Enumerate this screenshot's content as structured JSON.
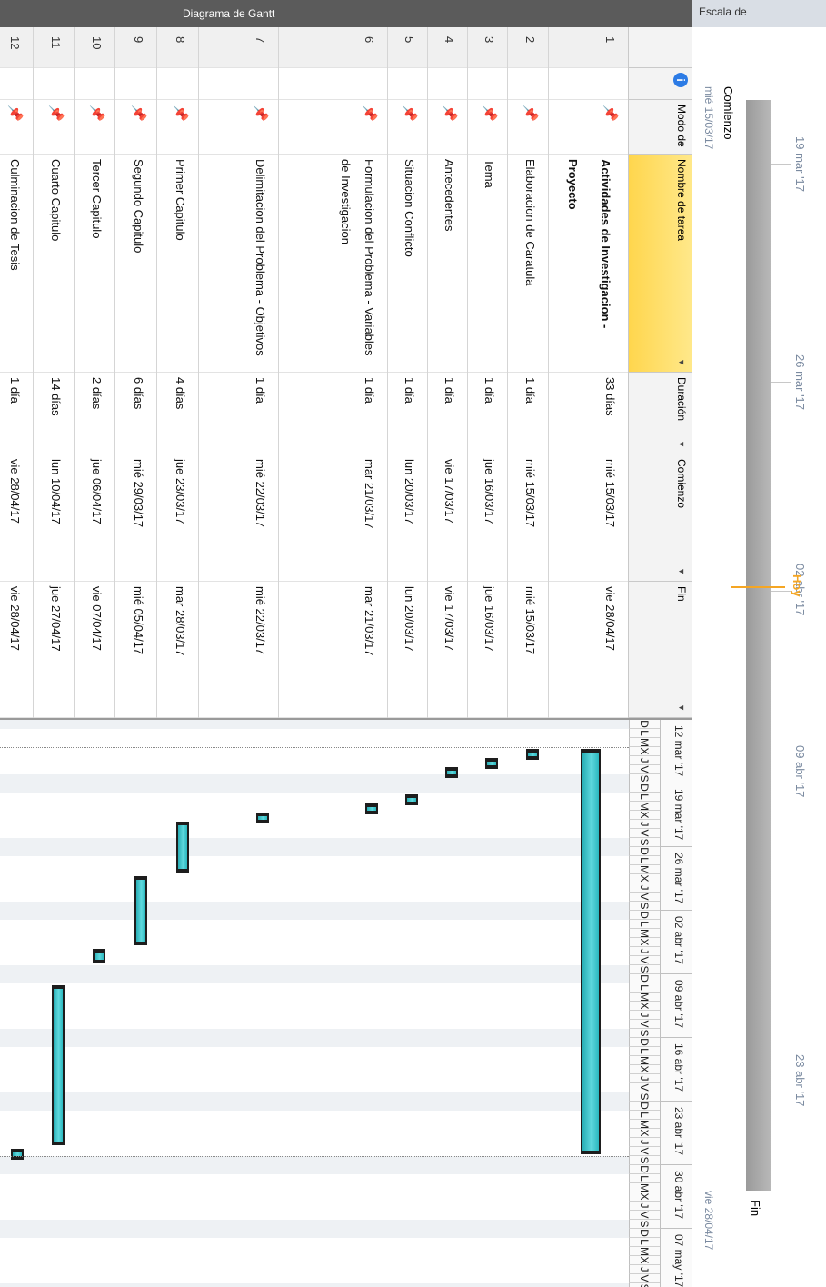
{
  "side": {
    "timeline_label": "Escala de",
    "gantt_label": "Diagrama de Gantt"
  },
  "timeline": {
    "start_label": "Comienzo",
    "start_date": "mié 15/03/17",
    "end_label": "Fin",
    "end_date": "vie 28/04/17",
    "today_label": "Hoy",
    "ticks": [
      "19 mar '17",
      "26 mar '17",
      "02 abr '17",
      "09 abr '17",
      "23 abr '17"
    ]
  },
  "columns": {
    "info_icon": "info-icon",
    "mode": "Modo de",
    "name": "Nombre de tarea",
    "duration": "Duración",
    "start": "Comienzo",
    "finish": "Fin",
    "dropdown_glyph": "▼"
  },
  "tasks": [
    {
      "id": "1",
      "name": "Actividades de Investigacion - Proyecto",
      "duration": "33 días",
      "start": "mié 15/03/17",
      "finish": "vie 28/04/17",
      "summary": true
    },
    {
      "id": "2",
      "name": "Elaboracion de Caratula",
      "duration": "1 día",
      "start": "mié 15/03/17",
      "finish": "mié 15/03/17"
    },
    {
      "id": "3",
      "name": "Tema",
      "duration": "1 día",
      "start": "jue 16/03/17",
      "finish": "jue 16/03/17"
    },
    {
      "id": "4",
      "name": "Antecedentes",
      "duration": "1 día",
      "start": "vie 17/03/17",
      "finish": "vie 17/03/17"
    },
    {
      "id": "5",
      "name": "Situacion Conflicto",
      "duration": "1 día",
      "start": "lun 20/03/17",
      "finish": "lun 20/03/17"
    },
    {
      "id": "6",
      "name": "Formulacion del Problema - Variables de Investigacion",
      "duration": "1 día",
      "start": "mar 21/03/17",
      "finish": "mar 21/03/17"
    },
    {
      "id": "7",
      "name": "Delimitacion del Problema - Objetivos",
      "duration": "1 día",
      "start": "mié 22/03/17",
      "finish": "mié 22/03/17"
    },
    {
      "id": "8",
      "name": "Primer Capitulo",
      "duration": "4 días",
      "start": "jue 23/03/17",
      "finish": "mar 28/03/17"
    },
    {
      "id": "9",
      "name": "Segundo Capitulo",
      "duration": "6 días",
      "start": "mié 29/03/17",
      "finish": "mié 05/04/17"
    },
    {
      "id": "10",
      "name": "Tercer Capitulo",
      "duration": "2 días",
      "start": "jue 06/04/17",
      "finish": "vie 07/04/17"
    },
    {
      "id": "11",
      "name": "Cuarto Capitulo",
      "duration": "14 días",
      "start": "lun 10/04/17",
      "finish": "jue 27/04/17"
    },
    {
      "id": "12",
      "name": "Culminacion de Tesis",
      "duration": "1 día",
      "start": "vie 28/04/17",
      "finish": "vie 28/04/17"
    }
  ],
  "gantt": {
    "weeks": [
      "12 mar '17",
      "19 mar '17",
      "26 mar '17",
      "02 abr '17",
      "09 abr '17",
      "16 abr '17",
      "23 abr '17",
      "30 abr '17",
      "07 may '17"
    ],
    "day_letters": [
      "D",
      "L",
      "M",
      "X",
      "J",
      "V",
      "S"
    ],
    "bar_color": "#3cc4ca",
    "today_color": "#f5a623"
  }
}
